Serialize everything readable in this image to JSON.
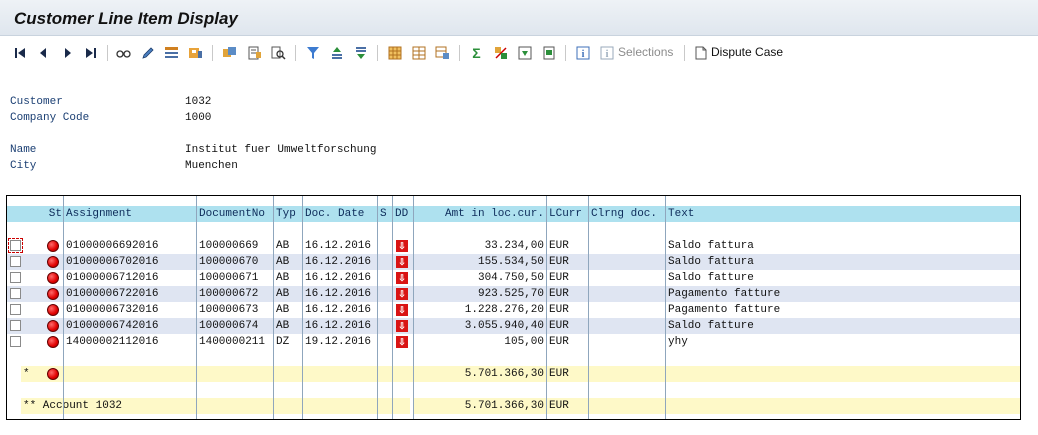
{
  "window": {
    "title": "Customer Line Item Display"
  },
  "toolbar": {
    "selections_label": "Selections",
    "dispute_label": "Dispute Case",
    "icons": [
      "first-page-icon",
      "previous-page-icon",
      "next-page-icon",
      "last-page-icon",
      "glasses-icon",
      "pencil-icon",
      "select-layout-icon",
      "save-layout-icon",
      "choose-icon",
      "details-icon",
      "find-icon",
      "filter-icon",
      "sort-ascending-icon",
      "sort-descending-icon",
      "layout-grid-icon",
      "change-layout-icon",
      "select-layout-icon2",
      "sum-icon",
      "subtotal-icon",
      "export-icon",
      "print-icon",
      "info-icon",
      "selections-info-icon",
      "document-icon"
    ]
  },
  "header": {
    "customer_label": "Customer",
    "customer_value": "1032",
    "company_label": "Company Code",
    "company_value": "1000",
    "name_label": "Name",
    "name_value": "Institut fuer Umweltforschung",
    "city_label": "City",
    "city_value": "Muenchen"
  },
  "table": {
    "columns": {
      "st": "St",
      "assignment": "Assignment",
      "docno": "DocumentNo",
      "typ": "Typ",
      "docdate": "Doc. Date",
      "s": "S",
      "dd": "DD",
      "amt": "Amt in loc.cur.",
      "lcurr": "LCurr",
      "clrng": "Clrng doc.",
      "text": "Text"
    },
    "rows": [
      {
        "assignment": "01000006692016",
        "docno": "100000669",
        "typ": "AB",
        "date": "16.12.2016",
        "amt": "33.234,00",
        "curr": "EUR",
        "text": "Saldo fattura"
      },
      {
        "assignment": "01000006702016",
        "docno": "100000670",
        "typ": "AB",
        "date": "16.12.2016",
        "amt": "155.534,50",
        "curr": "EUR",
        "text": "Saldo fattura"
      },
      {
        "assignment": "01000006712016",
        "docno": "100000671",
        "typ": "AB",
        "date": "16.12.2016",
        "amt": "304.750,50",
        "curr": "EUR",
        "text": "Saldo fatture"
      },
      {
        "assignment": "01000006722016",
        "docno": "100000672",
        "typ": "AB",
        "date": "16.12.2016",
        "amt": "923.525,70",
        "curr": "EUR",
        "text": "Pagamento fatture"
      },
      {
        "assignment": "01000006732016",
        "docno": "100000673",
        "typ": "AB",
        "date": "16.12.2016",
        "amt": "1.228.276,20",
        "curr": "EUR",
        "text": "Pagamento fatture"
      },
      {
        "assignment": "01000006742016",
        "docno": "100000674",
        "typ": "AB",
        "date": "16.12.2016",
        "amt": "3.055.940,40",
        "curr": "EUR",
        "text": "Saldo fatture"
      },
      {
        "assignment": "14000002112016",
        "docno": "1400000211",
        "typ": "DZ",
        "date": "19.12.2016",
        "amt": "105,00",
        "curr": "EUR",
        "text": "yhy"
      }
    ],
    "total": {
      "marker": "*",
      "amt": "5.701.366,30",
      "curr": "EUR"
    },
    "account_total": {
      "label": "** Account 1032",
      "amt": "5.701.366,30",
      "curr": "EUR"
    },
    "dd_glyph": "⇩"
  },
  "colors": {
    "header_row": "#aee1ef",
    "alt_row": "#dfe5f2",
    "sum_row": "#fef9c8",
    "status_red": "#e00000"
  }
}
